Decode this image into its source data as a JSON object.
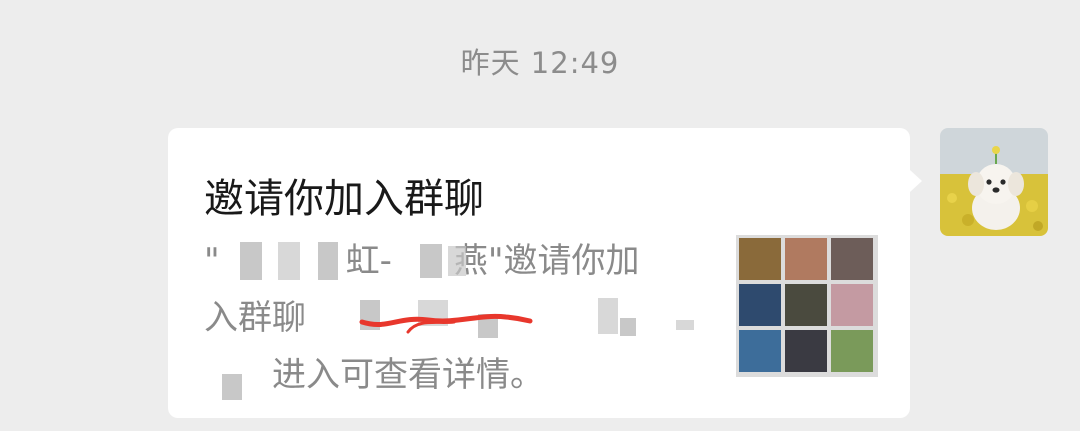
{
  "chat": {
    "timestamp": "昨天 12:49",
    "message": {
      "title": "邀请你加入群聊",
      "desc_line1_a": "\"",
      "desc_line1_b": "虹-",
      "desc_line1_c": "燕\"邀请你加",
      "desc_line2": "入群聊",
      "desc_line3": "进入可查看详情。",
      "group_avatar_cells": [
        "#8a6a3a",
        "#b07a60",
        "#6d5d59",
        "#2e4a6e",
        "#4a4a3e",
        "#c49aa2",
        "#3d6d9a",
        "#3a3a42",
        "#7a9a5a"
      ]
    },
    "sender": {
      "avatar_icon": "dog-avatar-icon",
      "accent": "#ffffff"
    }
  },
  "colors": {
    "background": "#ededed",
    "bubble": "#ffffff",
    "timestamp": "#8c8c8c",
    "redaction_stroke": "#e8372c"
  }
}
